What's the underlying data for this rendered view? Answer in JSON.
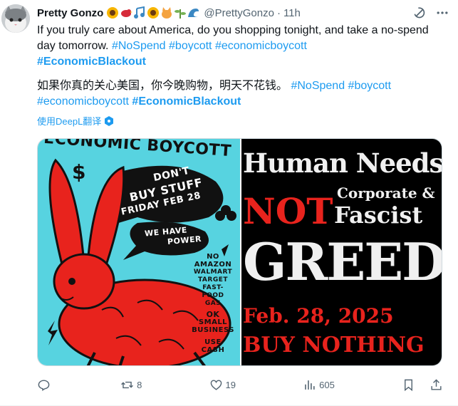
{
  "author": {
    "name": "Pretty Gonzo",
    "handle": "@PrettyGonzo",
    "time": "11h",
    "name_emojis": [
      "sunflower",
      "bird",
      "music-notes",
      "sunflower",
      "cat",
      "herb",
      "wave"
    ]
  },
  "post": {
    "line1": "If you truly care about America, do you shopping tonight, and take a no-spend day tomorrow.",
    "tags1": [
      "#NoSpend",
      "#boycott",
      "#economicboycott"
    ],
    "tag_bold": "#EconomicBlackout",
    "line2": "如果你真的关心美国，你今晚购物，明天不花钱。",
    "tags2": [
      "#NoSpend",
      "#boycott",
      "#economicboycott"
    ],
    "translate_label": "使用DeepL翻译"
  },
  "left_poster": {
    "header": "ECONOMIC BOYCOTT",
    "bubble": [
      "DON'T",
      "BUY STUFF",
      "FRIDAY FEB 28"
    ],
    "power": [
      "WE HAVE",
      "POWER"
    ],
    "list": [
      "NO",
      "AMAZON",
      "WALMART",
      "TARGET",
      "FAST-",
      "FOOD",
      "GAS"
    ],
    "ok": [
      "OK",
      "SMALL",
      "BUSINESS"
    ],
    "use": [
      "USE",
      "CASH"
    ],
    "dollar": "$"
  },
  "right_poster": {
    "line1": "Human Needs",
    "line2a": "NOT",
    "line2b": "Corporate &",
    "line2c": "Fascist",
    "line3": "GREED",
    "line4": "Feb. 28, 2025",
    "line5": "BUY NOTHING"
  },
  "actions": {
    "reply": "",
    "retweet": "8",
    "like": "19",
    "views": "605"
  },
  "colors": {
    "link": "#1d9bf0",
    "text": "#0f1419",
    "muted": "#536471",
    "poster_cyan": "#57d3e0",
    "poster_red": "#e8231d"
  }
}
